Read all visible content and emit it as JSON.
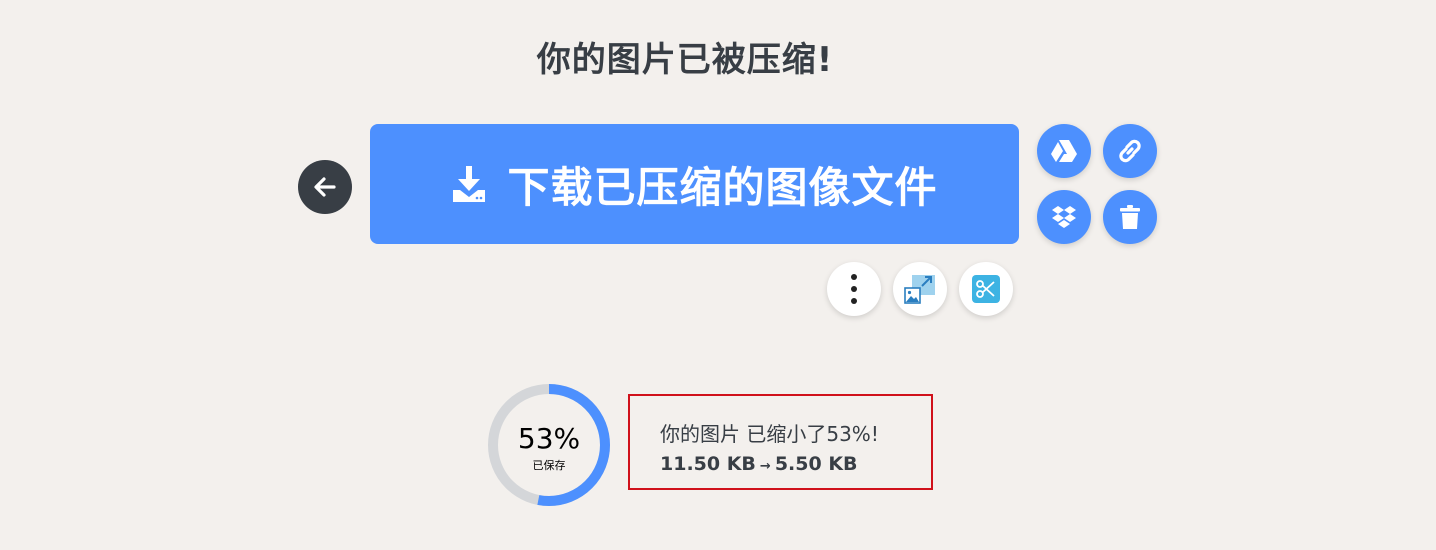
{
  "header": {
    "title": "你的图片已被压缩!"
  },
  "actions": {
    "back_icon": "arrow-left-icon",
    "download_label": "下载已压缩的图像文件",
    "download_icon": "download-icon",
    "cloud_buttons": [
      {
        "icon": "google-drive-icon"
      },
      {
        "icon": "link-icon"
      },
      {
        "icon": "dropbox-icon"
      },
      {
        "icon": "trash-icon"
      }
    ],
    "tool_buttons": [
      {
        "icon": "more-vertical-icon"
      },
      {
        "icon": "resize-image-icon"
      },
      {
        "icon": "crop-scissors-icon"
      }
    ]
  },
  "result": {
    "percent_saved": "53%",
    "percent_value": 0.53,
    "saved_label": "已保存",
    "summary_prefix": "你的图片 已缩小了",
    "summary_percent": "53%",
    "summary_suffix": "!",
    "size_before": "11.50 KB",
    "size_after": "5.50 KB",
    "size_arrow": "→"
  },
  "colors": {
    "background": "#f3f0ed",
    "primary": "#4d90fe",
    "dark": "#383e45",
    "ring_track": "#d4d6d9",
    "highlight_border": "#d0111b",
    "tool_accent": "#3db3e3"
  }
}
